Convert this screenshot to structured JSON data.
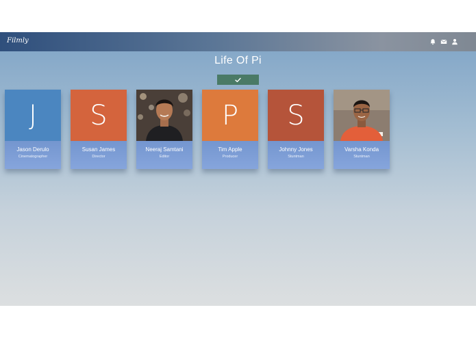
{
  "app": {
    "brand": "Filmly"
  },
  "nav": {
    "icons": [
      "bell-icon",
      "mail-icon",
      "user-icon"
    ]
  },
  "page": {
    "title": "Life Of Pi",
    "approve_icon": "check-icon"
  },
  "colors": {
    "approve": "#4a7a66",
    "card_bottom": "#7a9bd2"
  },
  "crew": [
    {
      "initial": "J",
      "name": "Jason Derulo",
      "role": "Cinematographer",
      "avatar_color": "#4b86c0",
      "photo": false
    },
    {
      "initial": "S",
      "name": "Susan James",
      "role": "Director",
      "avatar_color": "#d4643d",
      "photo": false
    },
    {
      "initial": "",
      "name": "Neeraj Samtani",
      "role": "Editor",
      "avatar_color": "#3a3430",
      "photo": true
    },
    {
      "initial": "P",
      "name": "Tim Apple",
      "role": "Producer",
      "avatar_color": "#dd7a3c",
      "photo": false
    },
    {
      "initial": "S",
      "name": "Johnny Jones",
      "role": "Stuntman",
      "avatar_color": "#b5543a",
      "photo": false
    },
    {
      "initial": "",
      "name": "Varsha Konda",
      "role": "Stuntman",
      "avatar_color": "#8c7d70",
      "photo": true
    }
  ]
}
